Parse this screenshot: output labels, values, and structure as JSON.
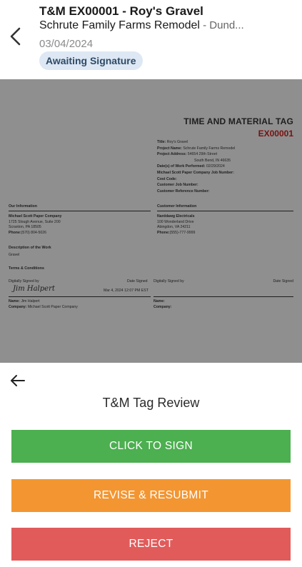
{
  "header": {
    "back_icon": "chevron-left-icon",
    "title": "T&M EX00001 - Roy's Gravel",
    "subtitle_project": "Schrute Family Farms Remodel",
    "subtitle_sep": " - ",
    "subtitle_location": "Dund...",
    "date": "03/04/2024",
    "status_badge": "Awaiting Signature"
  },
  "document": {
    "heading": "TIME AND MATERIAL TAG",
    "number": "EX00001",
    "title_label": "Title:",
    "title_value": "Roy's Gravel",
    "project_name_label": "Project Name:",
    "project_name_value": "Schrute Family Farms Remodel",
    "project_address_label": "Project Address:",
    "project_address_line1": "54654 29th Street",
    "project_address_line2": "South Bend, IN 46635",
    "dates_label": "Date(s) of Work Performed:",
    "dates_value": "02/29/2024",
    "job_number_label": "Michael Scott Paper Company Job Number:",
    "cost_code_label": "Cost Code:",
    "customer_job_label": "Customer Job Number:",
    "customer_ref_label": "Customer Reference Number:",
    "our_info_title": "Our Information",
    "customer_info_title": "Customer Information",
    "our_company": "Michael Scott Paper Company",
    "our_address1": "1725 Slough Avenue, Suite 200",
    "our_address2": "Scranton, PA 18505",
    "our_phone_label": "Phone:",
    "our_phone": "(570) 804-5026",
    "customer_company": "Narddawg Electricals",
    "customer_address1": "100 Wonderland Drive",
    "customer_address2": "Abingdon, VA 24211",
    "customer_phone_label": "Phone:",
    "customer_phone": "(555)-777-9999",
    "description_title": "Description of the Work",
    "description_value": "Gravel",
    "terms_title": "Terms & Conditions",
    "digitally_signed_by_left": "Digitally Signed by",
    "date_signed_left": "Date Signed",
    "signature_script": "Jim Halpert",
    "signed_datetime": "Mar 4, 2024 12:07 PM EST",
    "digitally_signed_by_right": "Digitally Signed by",
    "date_signed_right": "Date Signed",
    "name_label": "Name:",
    "name_value": "Jim Halpert",
    "company_label": "Company:",
    "company_value": "Michael Scott Paper Company",
    "right_name_label": "Name:",
    "right_company_label": "Company:"
  },
  "review": {
    "back_icon": "arrow-left-icon",
    "title": "T&M Tag Review",
    "sign_label": "CLICK TO SIGN",
    "revise_label": "REVISE & RESUBMIT",
    "reject_label": "REJECT"
  },
  "colors": {
    "sign": "#4caf50",
    "revise": "#f39632",
    "reject": "#e15b5b",
    "badge_bg": "#dde8f4",
    "overlay": "#8f8f8f"
  }
}
